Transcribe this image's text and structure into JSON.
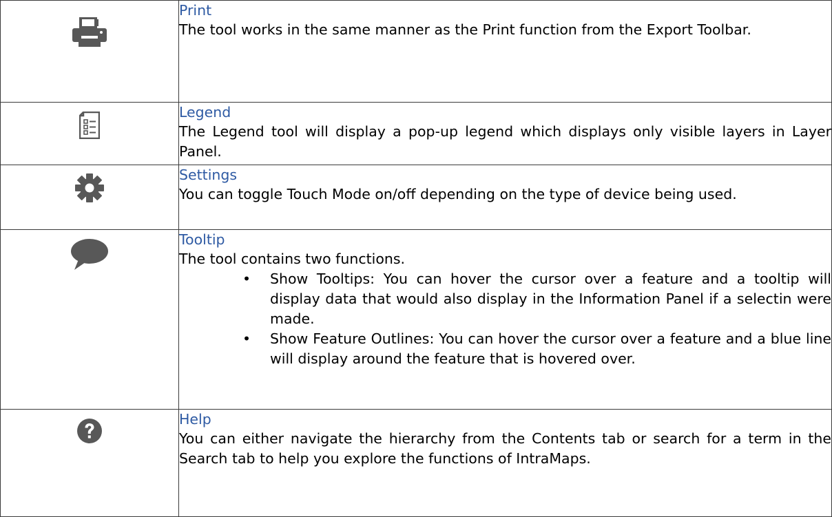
{
  "rows": [
    {
      "icon": "printer-icon",
      "title": "Print",
      "description": "The tool works in the same manner as the Print function from the Export Toolbar."
    },
    {
      "icon": "legend-icon",
      "title": "Legend",
      "description": "The Legend tool will display a pop-up legend which displays only visible layers in Layer Panel."
    },
    {
      "icon": "gear-icon",
      "title": "Settings",
      "description": "You can toggle Touch Mode on/off depending on the type of device being used."
    },
    {
      "icon": "speech-bubble-icon",
      "title": "Tooltip",
      "description": "The tool contains two functions.",
      "bullets": [
        "Show Tooltips: You can hover the cursor over a feature and a tooltip will display data that would also display in the Information Panel if a selectin were made.",
        "Show Feature Outlines: You can hover the cursor over a feature and a blue line will display around the feature that is hovered over."
      ]
    },
    {
      "icon": "question-icon",
      "title": "Help",
      "description": "You can either navigate the hierarchy from the Contents tab or search for a term in the Search tab to help you explore the functions of IntraMaps."
    }
  ],
  "colors": {
    "title": "#2e5aa3",
    "icon": "#585858",
    "border": "#3a3a3a"
  }
}
